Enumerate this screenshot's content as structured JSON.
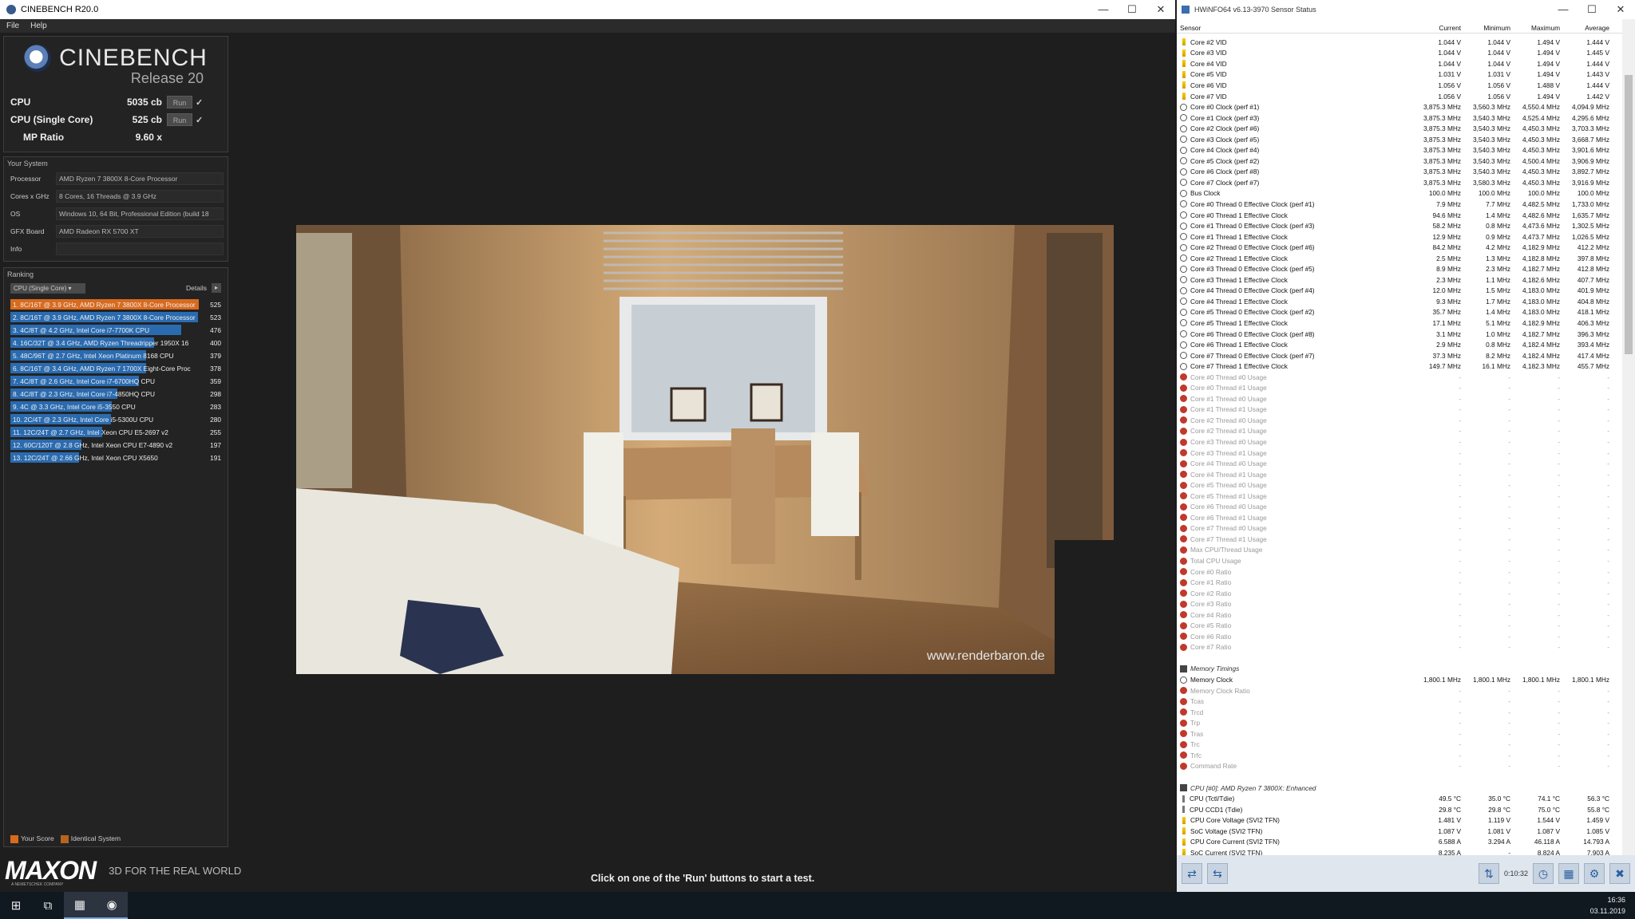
{
  "cinebench": {
    "window_title": "CINEBENCH R20.0",
    "menu": [
      "File",
      "Help"
    ],
    "logo_text": "CINEBENCH",
    "release": "Release 20",
    "cpu_label": "CPU",
    "cpu_score": "5035 cb",
    "single_label": "CPU (Single Core)",
    "single_score": "525 cb",
    "mp_label": "MP Ratio",
    "mp_value": "9.60 x",
    "run_label": "Run",
    "check": "✓",
    "system_heading": "Your System",
    "system": [
      {
        "k": "Processor",
        "v": "AMD Ryzen 7 3800X 8-Core Processor"
      },
      {
        "k": "Cores x GHz",
        "v": "8 Cores, 16 Threads @ 3.9 GHz"
      },
      {
        "k": "OS",
        "v": "Windows 10, 64 Bit, Professional Edition (build 18"
      },
      {
        "k": "GFX Board",
        "v": "AMD Radeon RX 5700 XT"
      },
      {
        "k": "Info",
        "v": ""
      }
    ],
    "ranking_heading": "Ranking",
    "ranking_dropdown": "CPU (Single Core)",
    "details_label": "Details",
    "ranking": [
      {
        "name": "1. 8C/16T @ 3.9 GHz, AMD Ryzen 7 3800X 8-Core Processor",
        "score": "525",
        "fill": 1.0,
        "color": "#d86a1e"
      },
      {
        "name": "2. 8C/16T @ 3.9 GHz, AMD Ryzen 7 3800X 8-Core Processor",
        "score": "523",
        "fill": 0.996,
        "color": "#2a6bb0"
      },
      {
        "name": "3. 4C/8T @ 4.2 GHz, Intel Core i7-7700K CPU",
        "score": "476",
        "fill": 0.907,
        "color": "#2a6bb0"
      },
      {
        "name": "4. 16C/32T @ 3.4 GHz, AMD Ryzen Threadripper 1950X 16",
        "score": "400",
        "fill": 0.762,
        "color": "#2a6bb0"
      },
      {
        "name": "5. 48C/96T @ 2.7 GHz, Intel Xeon Platinum 8168 CPU",
        "score": "379",
        "fill": 0.722,
        "color": "#2a6bb0"
      },
      {
        "name": "6. 8C/16T @ 3.4 GHz, AMD Ryzen 7 1700X Eight-Core Proc",
        "score": "378",
        "fill": 0.72,
        "color": "#2a6bb0"
      },
      {
        "name": "7. 4C/8T @ 2.6 GHz, Intel Core i7-6700HQ CPU",
        "score": "359",
        "fill": 0.684,
        "color": "#2a6bb0"
      },
      {
        "name": "8. 4C/8T @ 2.3 GHz, Intel Core i7-4850HQ CPU",
        "score": "298",
        "fill": 0.568,
        "color": "#2a6bb0"
      },
      {
        "name": "9. 4C @ 3.3 GHz, Intel Core i5-3550 CPU",
        "score": "283",
        "fill": 0.539,
        "color": "#2a6bb0"
      },
      {
        "name": "10. 2C/4T @ 2.3 GHz, Intel Core i5-5300U CPU",
        "score": "280",
        "fill": 0.533,
        "color": "#2a6bb0"
      },
      {
        "name": "11. 12C/24T @ 2.7 GHz, Intel Xeon CPU E5-2697 v2",
        "score": "255",
        "fill": 0.486,
        "color": "#2a6bb0"
      },
      {
        "name": "12. 60C/120T @ 2.8 GHz, Intel Xeon CPU E7-4890 v2",
        "score": "197",
        "fill": 0.375,
        "color": "#2a6bb0"
      },
      {
        "name": "13. 12C/24T @ 2.66 GHz, Intel Xeon CPU X5650",
        "score": "191",
        "fill": 0.364,
        "color": "#2a6bb0"
      }
    ],
    "legend_your": "Your Score",
    "legend_identical": "Identical System",
    "maxon_logo": "MAXON",
    "maxon_sub": "A NEMETSCHEK COMPANY",
    "maxon_tag": "3D FOR THE REAL WORLD",
    "watermark": "www.renderbaron.de",
    "hint": "Click on one of the 'Run' buttons to start a test."
  },
  "hwinfo": {
    "window_title": "HWiNFO64 v6.13-3970 Sensor Status",
    "headers": [
      "Sensor",
      "Current",
      "Minimum",
      "Maximum",
      "Average"
    ],
    "rows": [
      {
        "i": "v",
        "n": "Core #2 VID",
        "c": "1.044 V",
        "mi": "1.044 V",
        "ma": "1.494 V",
        "a": "1.444 V"
      },
      {
        "i": "v",
        "n": "Core #3 VID",
        "c": "1.044 V",
        "mi": "1.044 V",
        "ma": "1.494 V",
        "a": "1.445 V"
      },
      {
        "i": "v",
        "n": "Core #4 VID",
        "c": "1.044 V",
        "mi": "1.044 V",
        "ma": "1.494 V",
        "a": "1.444 V"
      },
      {
        "i": "v",
        "n": "Core #5 VID",
        "c": "1.031 V",
        "mi": "1.031 V",
        "ma": "1.494 V",
        "a": "1.443 V"
      },
      {
        "i": "v",
        "n": "Core #6 VID",
        "c": "1.056 V",
        "mi": "1.056 V",
        "ma": "1.488 V",
        "a": "1.444 V"
      },
      {
        "i": "v",
        "n": "Core #7 VID",
        "c": "1.056 V",
        "mi": "1.056 V",
        "ma": "1.494 V",
        "a": "1.442 V"
      },
      {
        "i": "c",
        "n": "Core #0 Clock (perf #1)",
        "c": "3,875.3 MHz",
        "mi": "3,560.3 MHz",
        "ma": "4,550.4 MHz",
        "a": "4,094.9 MHz"
      },
      {
        "i": "c",
        "n": "Core #1 Clock (perf #3)",
        "c": "3,875.3 MHz",
        "mi": "3,540.3 MHz",
        "ma": "4,525.4 MHz",
        "a": "4,295.6 MHz"
      },
      {
        "i": "c",
        "n": "Core #2 Clock (perf #6)",
        "c": "3,875.3 MHz",
        "mi": "3,540.3 MHz",
        "ma": "4,450.3 MHz",
        "a": "3,703.3 MHz"
      },
      {
        "i": "c",
        "n": "Core #3 Clock (perf #5)",
        "c": "3,875.3 MHz",
        "mi": "3,540.3 MHz",
        "ma": "4,450.3 MHz",
        "a": "3,668.7 MHz"
      },
      {
        "i": "c",
        "n": "Core #4 Clock (perf #4)",
        "c": "3,875.3 MHz",
        "mi": "3,540.3 MHz",
        "ma": "4,450.3 MHz",
        "a": "3,901.6 MHz"
      },
      {
        "i": "c",
        "n": "Core #5 Clock (perf #2)",
        "c": "3,875.3 MHz",
        "mi": "3,540.3 MHz",
        "ma": "4,500.4 MHz",
        "a": "3,906.9 MHz"
      },
      {
        "i": "c",
        "n": "Core #6 Clock (perf #8)",
        "c": "3,875.3 MHz",
        "mi": "3,540.3 MHz",
        "ma": "4,450.3 MHz",
        "a": "3,892.7 MHz"
      },
      {
        "i": "c",
        "n": "Core #7 Clock (perf #7)",
        "c": "3,875.3 MHz",
        "mi": "3,580.3 MHz",
        "ma": "4,450.3 MHz",
        "a": "3,916.9 MHz"
      },
      {
        "i": "c",
        "n": "Bus Clock",
        "c": "100.0 MHz",
        "mi": "100.0 MHz",
        "ma": "100.0 MHz",
        "a": "100.0 MHz"
      },
      {
        "i": "c",
        "n": "Core #0 Thread 0 Effective Clock (perf #1)",
        "c": "7.9 MHz",
        "mi": "7.7 MHz",
        "ma": "4,482.5 MHz",
        "a": "1,733.0 MHz"
      },
      {
        "i": "c",
        "n": "Core #0 Thread 1 Effective Clock",
        "c": "94.6 MHz",
        "mi": "1.4 MHz",
        "ma": "4,482.6 MHz",
        "a": "1,635.7 MHz"
      },
      {
        "i": "c",
        "n": "Core #1 Thread 0 Effective Clock (perf #3)",
        "c": "58.2 MHz",
        "mi": "0.8 MHz",
        "ma": "4,473.6 MHz",
        "a": "1,302.5 MHz"
      },
      {
        "i": "c",
        "n": "Core #1 Thread 1 Effective Clock",
        "c": "12.9 MHz",
        "mi": "0.9 MHz",
        "ma": "4,473.7 MHz",
        "a": "1,026.5 MHz"
      },
      {
        "i": "c",
        "n": "Core #2 Thread 0 Effective Clock (perf #6)",
        "c": "84.2 MHz",
        "mi": "4.2 MHz",
        "ma": "4,182.9 MHz",
        "a": "412.2 MHz"
      },
      {
        "i": "c",
        "n": "Core #2 Thread 1 Effective Clock",
        "c": "2.5 MHz",
        "mi": "1.3 MHz",
        "ma": "4,182.8 MHz",
        "a": "397.8 MHz"
      },
      {
        "i": "c",
        "n": "Core #3 Thread 0 Effective Clock (perf #5)",
        "c": "8.9 MHz",
        "mi": "2.3 MHz",
        "ma": "4,182.7 MHz",
        "a": "412.8 MHz"
      },
      {
        "i": "c",
        "n": "Core #3 Thread 1 Effective Clock",
        "c": "2.3 MHz",
        "mi": "1.1 MHz",
        "ma": "4,182.6 MHz",
        "a": "407.7 MHz"
      },
      {
        "i": "c",
        "n": "Core #4 Thread 0 Effective Clock (perf #4)",
        "c": "12.0 MHz",
        "mi": "1.5 MHz",
        "ma": "4,183.0 MHz",
        "a": "401.9 MHz"
      },
      {
        "i": "c",
        "n": "Core #4 Thread 1 Effective Clock",
        "c": "9.3 MHz",
        "mi": "1.7 MHz",
        "ma": "4,183.0 MHz",
        "a": "404.8 MHz"
      },
      {
        "i": "c",
        "n": "Core #5 Thread 0 Effective Clock (perf #2)",
        "c": "35.7 MHz",
        "mi": "1.4 MHz",
        "ma": "4,183.0 MHz",
        "a": "418.1 MHz"
      },
      {
        "i": "c",
        "n": "Core #5 Thread 1 Effective Clock",
        "c": "17.1 MHz",
        "mi": "5.1 MHz",
        "ma": "4,182.9 MHz",
        "a": "406.3 MHz"
      },
      {
        "i": "c",
        "n": "Core #6 Thread 0 Effective Clock (perf #8)",
        "c": "3.1 MHz",
        "mi": "1.0 MHz",
        "ma": "4,182.7 MHz",
        "a": "396.3 MHz"
      },
      {
        "i": "c",
        "n": "Core #6 Thread 1 Effective Clock",
        "c": "2.9 MHz",
        "mi": "0.8 MHz",
        "ma": "4,182.4 MHz",
        "a": "393.4 MHz"
      },
      {
        "i": "c",
        "n": "Core #7 Thread 0 Effective Clock (perf #7)",
        "c": "37.3 MHz",
        "mi": "8.2 MHz",
        "ma": "4,182.4 MHz",
        "a": "417.4 MHz"
      },
      {
        "i": "c",
        "n": "Core #7 Thread 1 Effective Clock",
        "c": "149.7 MHz",
        "mi": "16.1 MHz",
        "ma": "4,182.3 MHz",
        "a": "455.7 MHz"
      },
      {
        "i": "x",
        "n": "Core #0 Thread #0 Usage",
        "c": "-",
        "mi": "-",
        "ma": "-",
        "a": "-",
        "d": 1
      },
      {
        "i": "x",
        "n": "Core #0 Thread #1 Usage",
        "c": "-",
        "mi": "-",
        "ma": "-",
        "a": "-",
        "d": 1
      },
      {
        "i": "x",
        "n": "Core #1 Thread #0 Usage",
        "c": "-",
        "mi": "-",
        "ma": "-",
        "a": "-",
        "d": 1
      },
      {
        "i": "x",
        "n": "Core #1 Thread #1 Usage",
        "c": "-",
        "mi": "-",
        "ma": "-",
        "a": "-",
        "d": 1
      },
      {
        "i": "x",
        "n": "Core #2 Thread #0 Usage",
        "c": "-",
        "mi": "-",
        "ma": "-",
        "a": "-",
        "d": 1
      },
      {
        "i": "x",
        "n": "Core #2 Thread #1 Usage",
        "c": "-",
        "mi": "-",
        "ma": "-",
        "a": "-",
        "d": 1
      },
      {
        "i": "x",
        "n": "Core #3 Thread #0 Usage",
        "c": "-",
        "mi": "-",
        "ma": "-",
        "a": "-",
        "d": 1
      },
      {
        "i": "x",
        "n": "Core #3 Thread #1 Usage",
        "c": "-",
        "mi": "-",
        "ma": "-",
        "a": "-",
        "d": 1
      },
      {
        "i": "x",
        "n": "Core #4 Thread #0 Usage",
        "c": "-",
        "mi": "-",
        "ma": "-",
        "a": "-",
        "d": 1
      },
      {
        "i": "x",
        "n": "Core #4 Thread #1 Usage",
        "c": "-",
        "mi": "-",
        "ma": "-",
        "a": "-",
        "d": 1
      },
      {
        "i": "x",
        "n": "Core #5 Thread #0 Usage",
        "c": "-",
        "mi": "-",
        "ma": "-",
        "a": "-",
        "d": 1
      },
      {
        "i": "x",
        "n": "Core #5 Thread #1 Usage",
        "c": "-",
        "mi": "-",
        "ma": "-",
        "a": "-",
        "d": 1
      },
      {
        "i": "x",
        "n": "Core #6 Thread #0 Usage",
        "c": "-",
        "mi": "-",
        "ma": "-",
        "a": "-",
        "d": 1
      },
      {
        "i": "x",
        "n": "Core #6 Thread #1 Usage",
        "c": "-",
        "mi": "-",
        "ma": "-",
        "a": "-",
        "d": 1
      },
      {
        "i": "x",
        "n": "Core #7 Thread #0 Usage",
        "c": "-",
        "mi": "-",
        "ma": "-",
        "a": "-",
        "d": 1
      },
      {
        "i": "x",
        "n": "Core #7 Thread #1 Usage",
        "c": "-",
        "mi": "-",
        "ma": "-",
        "a": "-",
        "d": 1
      },
      {
        "i": "x",
        "n": "Max CPU/Thread Usage",
        "c": "-",
        "mi": "-",
        "ma": "-",
        "a": "-",
        "d": 1
      },
      {
        "i": "x",
        "n": "Total CPU Usage",
        "c": "-",
        "mi": "-",
        "ma": "-",
        "a": "-",
        "d": 1
      },
      {
        "i": "x",
        "n": "Core #0 Ratio",
        "c": "-",
        "mi": "-",
        "ma": "-",
        "a": "-",
        "d": 1
      },
      {
        "i": "x",
        "n": "Core #1 Ratio",
        "c": "-",
        "mi": "-",
        "ma": "-",
        "a": "-",
        "d": 1
      },
      {
        "i": "x",
        "n": "Core #2 Ratio",
        "c": "-",
        "mi": "-",
        "ma": "-",
        "a": "-",
        "d": 1
      },
      {
        "i": "x",
        "n": "Core #3 Ratio",
        "c": "-",
        "mi": "-",
        "ma": "-",
        "a": "-",
        "d": 1
      },
      {
        "i": "x",
        "n": "Core #4 Ratio",
        "c": "-",
        "mi": "-",
        "ma": "-",
        "a": "-",
        "d": 1
      },
      {
        "i": "x",
        "n": "Core #5 Ratio",
        "c": "-",
        "mi": "-",
        "ma": "-",
        "a": "-",
        "d": 1
      },
      {
        "i": "x",
        "n": "Core #6 Ratio",
        "c": "-",
        "mi": "-",
        "ma": "-",
        "a": "-",
        "d": 1
      },
      {
        "i": "x",
        "n": "Core #7 Ratio",
        "c": "-",
        "mi": "-",
        "ma": "-",
        "a": "-",
        "d": 1
      },
      {
        "i": "e",
        "n": "",
        "c": "",
        "mi": "",
        "ma": "",
        "a": ""
      },
      {
        "i": "g",
        "n": "Memory Timings",
        "c": "",
        "mi": "",
        "ma": "",
        "a": "",
        "grp": 1
      },
      {
        "i": "c",
        "n": "Memory Clock",
        "c": "1,800.1 MHz",
        "mi": "1,800.1 MHz",
        "ma": "1,800.1 MHz",
        "a": "1,800.1 MHz"
      },
      {
        "i": "x",
        "n": "Memory Clock Ratio",
        "c": "-",
        "mi": "-",
        "ma": "-",
        "a": "-",
        "d": 1
      },
      {
        "i": "x",
        "n": "Tcas",
        "c": "-",
        "mi": "-",
        "ma": "-",
        "a": "-",
        "d": 1
      },
      {
        "i": "x",
        "n": "Trcd",
        "c": "-",
        "mi": "-",
        "ma": "-",
        "a": "-",
        "d": 1
      },
      {
        "i": "x",
        "n": "Trp",
        "c": "-",
        "mi": "-",
        "ma": "-",
        "a": "-",
        "d": 1
      },
      {
        "i": "x",
        "n": "Tras",
        "c": "-",
        "mi": "-",
        "ma": "-",
        "a": "-",
        "d": 1
      },
      {
        "i": "x",
        "n": "Trc",
        "c": "-",
        "mi": "-",
        "ma": "-",
        "a": "-",
        "d": 1
      },
      {
        "i": "x",
        "n": "Trfc",
        "c": "-",
        "mi": "-",
        "ma": "-",
        "a": "-",
        "d": 1
      },
      {
        "i": "x",
        "n": "Command Rate",
        "c": "-",
        "mi": "-",
        "ma": "-",
        "a": "-",
        "d": 1
      },
      {
        "i": "e",
        "n": "",
        "c": "",
        "mi": "",
        "ma": "",
        "a": ""
      },
      {
        "i": "g",
        "n": "CPU [#0]: AMD Ryzen 7 3800X: Enhanced",
        "c": "",
        "mi": "",
        "ma": "",
        "a": "",
        "grp": 1
      },
      {
        "i": "t",
        "n": "CPU (Tctl/Tdie)",
        "c": "49.5 °C",
        "mi": "35.0 °C",
        "ma": "74.1 °C",
        "a": "56.3 °C"
      },
      {
        "i": "t",
        "n": "CPU CCD1 (Tdie)",
        "c": "29.8 °C",
        "mi": "29.8 °C",
        "ma": "75.0 °C",
        "a": "55.8 °C"
      },
      {
        "i": "v",
        "n": "CPU Core Voltage (SVI2 TFN)",
        "c": "1.481 V",
        "mi": "1.119 V",
        "ma": "1.544 V",
        "a": "1.459 V"
      },
      {
        "i": "v",
        "n": "SoC Voltage (SVI2 TFN)",
        "c": "1.087 V",
        "mi": "1.081 V",
        "ma": "1.087 V",
        "a": "1.085 V"
      },
      {
        "i": "v",
        "n": "CPU Core Current (SVI2 TFN)",
        "c": "6.588 A",
        "mi": "3.294 A",
        "ma": "46.118 A",
        "a": "14.793 A"
      },
      {
        "i": "v",
        "n": "SoC Current (SVI2 TFN)",
        "c": "8.235 A",
        "mi": "-",
        "ma": "8.824 A",
        "a": "7.903 A"
      }
    ],
    "timer": "0:10:32"
  },
  "taskbar": {
    "time": "16:36",
    "date": "03.11.2019"
  }
}
